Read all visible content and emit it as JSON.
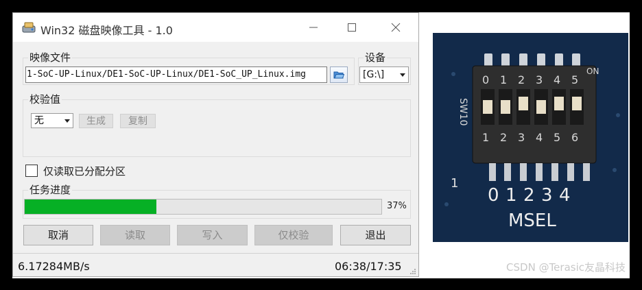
{
  "window": {
    "title": "Win32 磁盘映像工具 - 1.0",
    "minimize_icon": "minimize-icon",
    "maximize_icon": "maximize-icon",
    "close_icon": "close-icon"
  },
  "image_file": {
    "group_label": "映像文件",
    "path": "1-SoC-UP-Linux/DE1-SoC-UP-Linux/DE1-SoC_UP_Linux.img",
    "browse_icon": "folder-open-icon"
  },
  "device": {
    "group_label": "设备",
    "selected": "[G:\\]"
  },
  "checksum": {
    "group_label": "校验值",
    "type_selected": "无",
    "generate_label": "生成",
    "copy_label": "复制"
  },
  "options": {
    "read_only_allocated_label": "仅读取已分配分区",
    "read_only_allocated_checked": false
  },
  "progress": {
    "group_label": "任务进度",
    "percent_text": "37%",
    "fraction": 0.37,
    "color": "#06b025"
  },
  "buttons": {
    "cancel": "取消",
    "read": "读取",
    "write": "写入",
    "verify_only": "仅校验",
    "exit": "退出"
  },
  "status": {
    "speed": "6.17284MB/s",
    "time": "06:38/17:35"
  },
  "photo": {
    "switch_numbers_top": [
      "0",
      "1",
      "2",
      "3",
      "4",
      "5"
    ],
    "switch_numbers_bottom": [
      "1",
      "2",
      "3",
      "4",
      "5",
      "6"
    ],
    "pin_numbers": [
      "0",
      "1",
      "2",
      "3",
      "4"
    ],
    "msel_label": "MSEL",
    "sw_label": "SW10",
    "on_label": "ON",
    "dot_label": "1"
  },
  "watermark": "CSDN @Terasic友晶科技"
}
